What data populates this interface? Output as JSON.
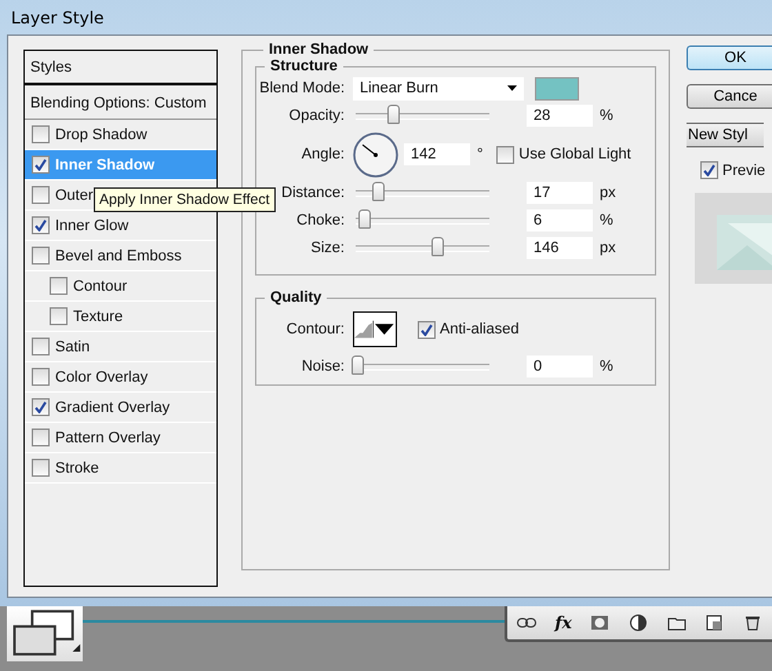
{
  "window": {
    "title": "Layer Style"
  },
  "styles_list": {
    "header": "Styles",
    "blending_options": "Blending Options: Custom",
    "items": [
      {
        "label": "Drop Shadow",
        "checked": false,
        "selected": false
      },
      {
        "label": "Inner Shadow",
        "checked": true,
        "selected": true
      },
      {
        "label": "Outer",
        "checked": false,
        "selected": false
      },
      {
        "label": "Inner Glow",
        "checked": true,
        "selected": false
      },
      {
        "label": "Bevel and Emboss",
        "checked": false,
        "selected": false,
        "children": [
          {
            "label": "Contour",
            "checked": false,
            "selected": false
          },
          {
            "label": "Texture",
            "checked": false,
            "selected": false
          }
        ]
      },
      {
        "label": "Satin",
        "checked": false,
        "selected": false
      },
      {
        "label": "Color Overlay",
        "checked": false,
        "selected": false
      },
      {
        "label": "Gradient Overlay",
        "checked": true,
        "selected": false
      },
      {
        "label": "Pattern Overlay",
        "checked": false,
        "selected": false
      },
      {
        "label": "Stroke",
        "checked": false,
        "selected": false
      }
    ]
  },
  "tooltip": "Apply Inner Shadow Effect",
  "panel": {
    "title": "Inner Shadow",
    "structure": {
      "title": "Structure",
      "rows": [
        {
          "kind": "blend",
          "label": "Blend Mode:",
          "value": "Linear Burn",
          "color": "#74c2c2"
        },
        {
          "kind": "slider",
          "label": "Opacity:",
          "level": 0.27,
          "value": "28",
          "unit": "%"
        },
        {
          "kind": "angle",
          "label": "Angle:",
          "value": "142",
          "unit": "°",
          "global_light": {
            "label": "Use Global Light",
            "checked": false
          }
        },
        {
          "kind": "slider",
          "label": "Distance:",
          "level": 0.15,
          "value": "17",
          "unit": "px"
        },
        {
          "kind": "slider",
          "label": "Choke:",
          "level": 0.05,
          "value": "6",
          "unit": "%"
        },
        {
          "kind": "slider",
          "label": "Size:",
          "level": 0.6,
          "value": "146",
          "unit": "px"
        }
      ]
    },
    "quality": {
      "title": "Quality",
      "rows": [
        {
          "kind": "contour",
          "label": "Contour:",
          "anti_aliased": {
            "label": "Anti-aliased",
            "checked": true
          }
        },
        {
          "kind": "slider",
          "label": "Noise:",
          "level": 0,
          "value": "0",
          "unit": "%"
        }
      ]
    }
  },
  "buttons": [
    {
      "label": "OK",
      "default": true
    },
    {
      "label": "Cance",
      "default": false
    },
    {
      "label": "New Styl",
      "default": false
    }
  ],
  "preview": {
    "label": "Previe",
    "checked": true
  },
  "layers_bar": {
    "fx": "fx"
  }
}
